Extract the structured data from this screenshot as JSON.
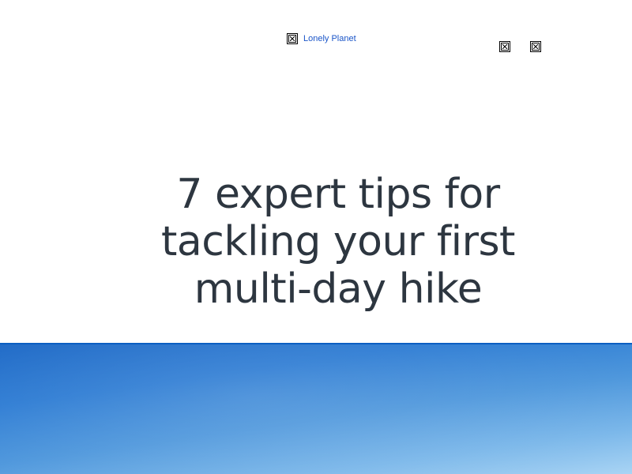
{
  "header": {
    "logo_alt": "Lonely Planet",
    "icons": [
      "broken-image-icon",
      "broken-image-icon"
    ]
  },
  "article": {
    "title": "7 expert tips for tackling your first multi-day hike"
  },
  "hero": {
    "description_colors": [
      "#1c68c6",
      "#a9d4f4"
    ]
  }
}
